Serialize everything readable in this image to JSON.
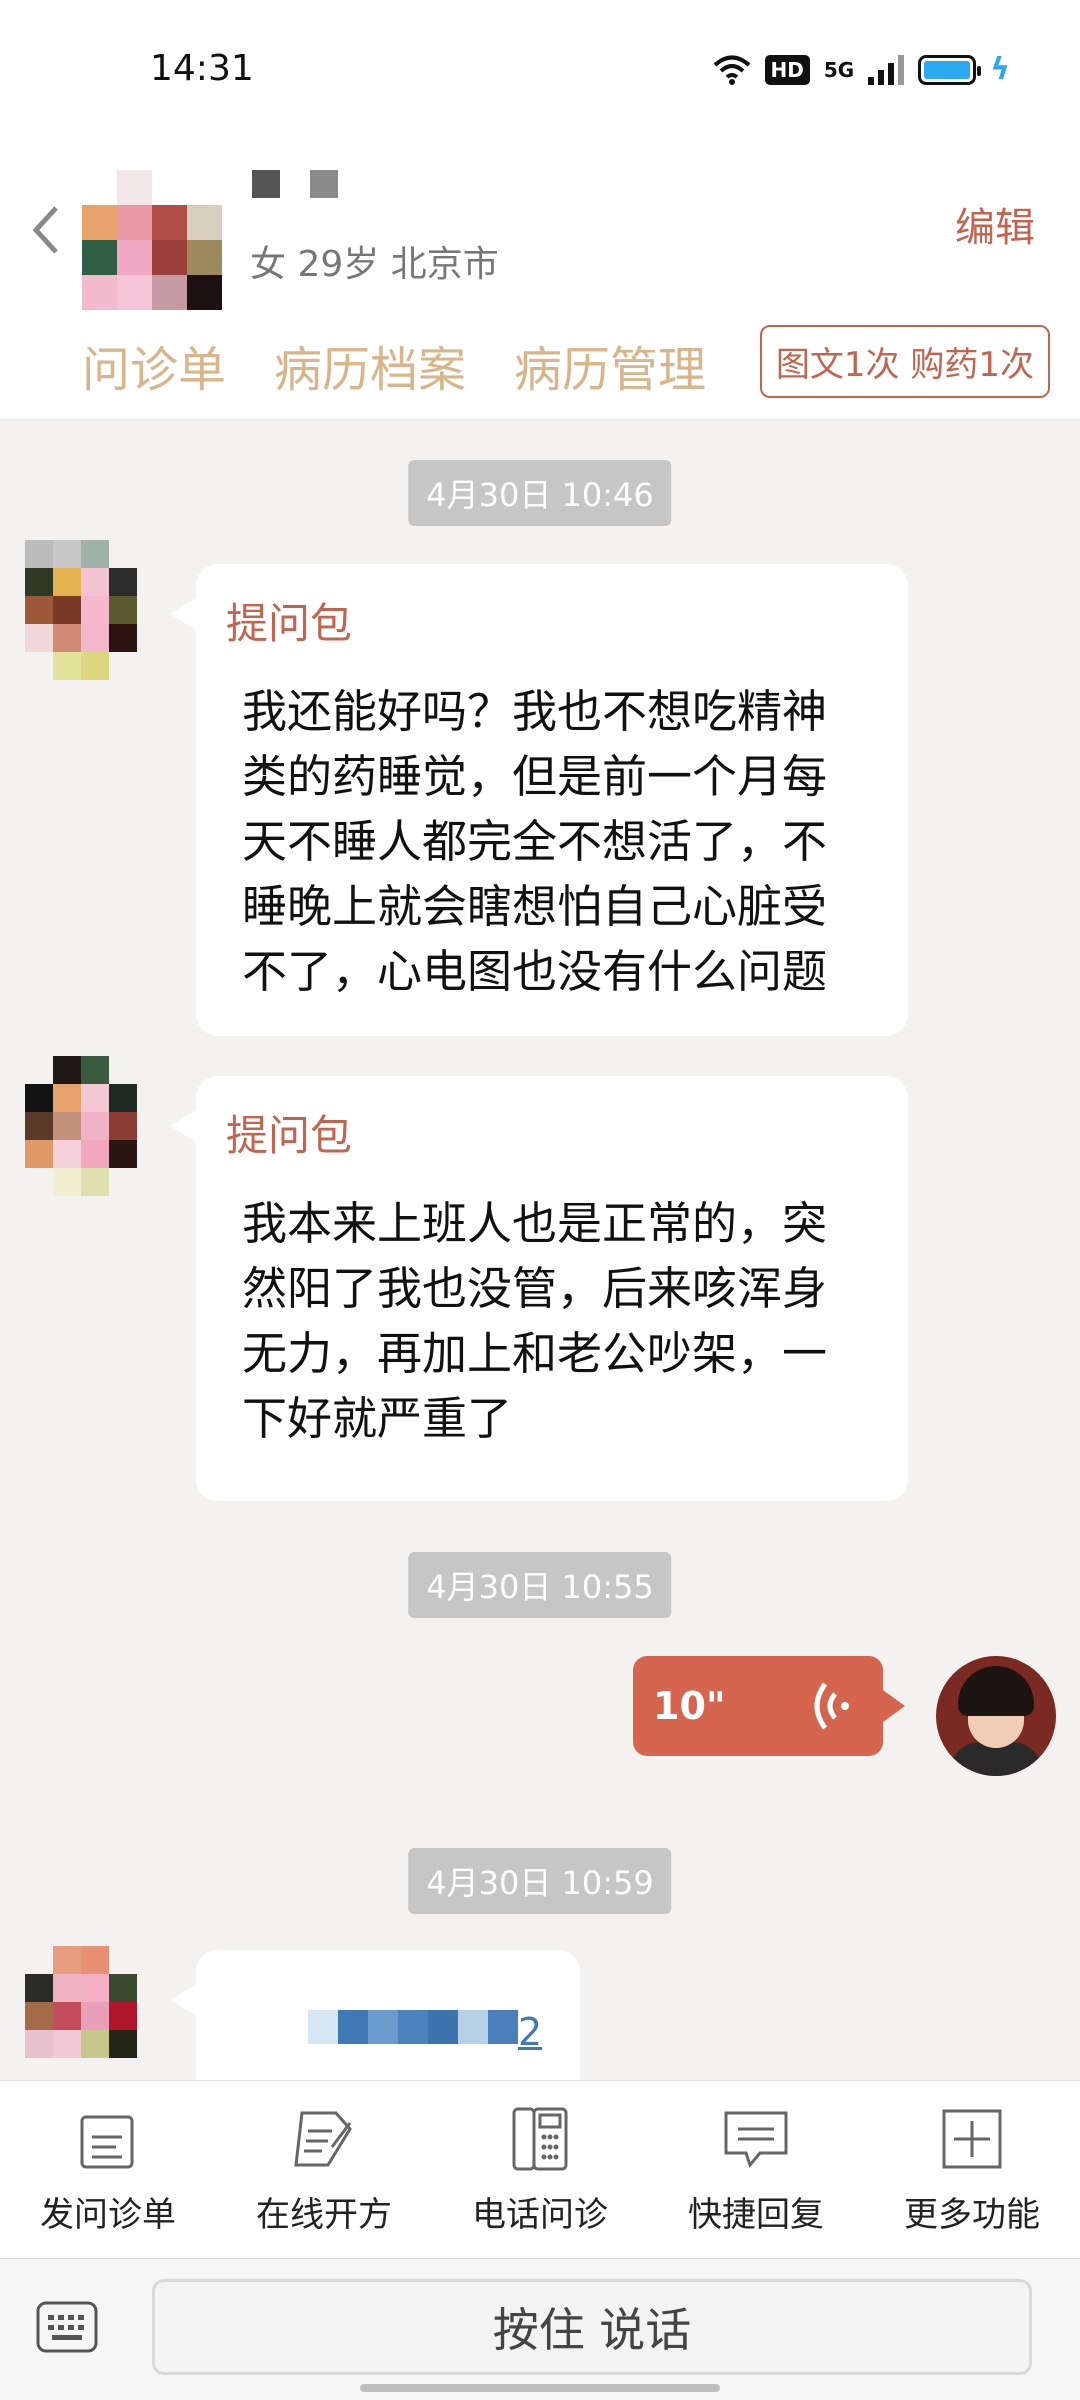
{
  "status_bar": {
    "time": "14:31",
    "hd": "HD",
    "network": "5G"
  },
  "header": {
    "patient_meta": "女 29岁  北京市",
    "edit": "编辑",
    "tabs": [
      "问诊单",
      "病历档案",
      "病历管理"
    ],
    "package_badge": "图文1次 购药1次"
  },
  "chat": {
    "messages": [
      {
        "timestamp": "4月30日 10:46",
        "tag": "提问包",
        "text_lines": [
          "我还能好吗？我也不想吃精神",
          "类的药睡觉，但是前一个月每",
          "天不睡人都完全不想活了，不",
          "睡晚上就会瞎想怕自己心脏受",
          "不了，心电图也没有什么问题"
        ]
      },
      {
        "tag": "提问包",
        "text_lines": [
          "我本来上班人也是正常的，突",
          "然阳了我也没管，后来咳浑身",
          "无力，再加上和老公吵架，一",
          "下好就严重了"
        ]
      }
    ],
    "voice_timestamp": "4月30日 10:55",
    "voice_length": "10\"",
    "last_timestamp": "4月30日 10:59",
    "partial_text_tail": "2"
  },
  "function_bar": [
    {
      "label": "发问诊单",
      "icon": "form-send-icon"
    },
    {
      "label": "在线开方",
      "icon": "prescription-icon"
    },
    {
      "label": "电话问诊",
      "icon": "phone-icon"
    },
    {
      "label": "快捷回复",
      "icon": "quick-reply-icon"
    },
    {
      "label": "更多功能",
      "icon": "plus-box-icon"
    }
  ],
  "input_bar": {
    "talk_button": "按住 说话"
  },
  "colors": {
    "accent": "#c3644e",
    "voice_bubble": "#d6654f",
    "tab_text": "#d9b589",
    "chat_bg": "#f3f2f1"
  }
}
